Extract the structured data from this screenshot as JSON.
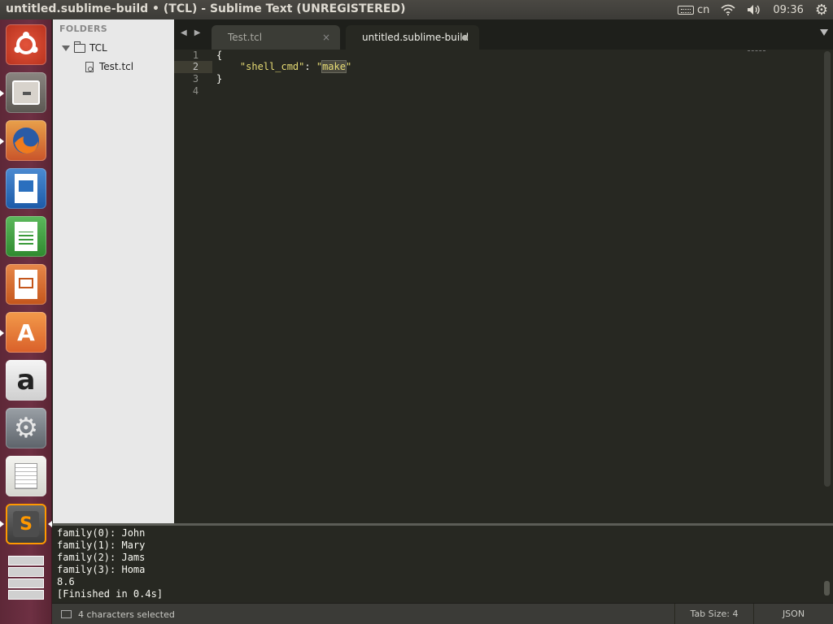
{
  "window": {
    "title": "untitled.sublime-build • (TCL) - Sublime Text (UNREGISTERED)"
  },
  "indicators": {
    "keyboard": "cn",
    "clock": "09:36"
  },
  "launcher": {
    "items": [
      "Ubuntu Dash",
      "Files",
      "Firefox Web Browser",
      "LibreOffice Writer",
      "LibreOffice Calc",
      "LibreOffice Impress",
      "Ubuntu Software Center",
      "Amazon",
      "System Settings",
      "Text Editor",
      "Sublime Text",
      "Workspace Switcher"
    ]
  },
  "sidebar": {
    "header": "FOLDERS",
    "folder": "TCL",
    "file": "Test.tcl"
  },
  "tabs": [
    {
      "label": "Test.tcl",
      "active": false,
      "close": "×"
    },
    {
      "label": "untitled.sublime-build",
      "active": true,
      "modified": true
    }
  ],
  "editor": {
    "line_numbers": [
      "1",
      "2",
      "3",
      "4"
    ],
    "code": {
      "l1": "{",
      "l2_indent": "    ",
      "l2_key": "\"shell_cmd\"",
      "l2_colon": ": ",
      "l2_q1": "\"",
      "l2_sel": "make",
      "l2_q2": "\"",
      "l3": "}"
    }
  },
  "output": {
    "lines": [
      "family(0): John",
      "family(1): Mary",
      "family(2): Jams",
      "family(3): Homa",
      "8.6",
      "[Finished in 0.4s]"
    ]
  },
  "statusbar": {
    "selection": "4 characters selected",
    "tab_size": "Tab Size: 4",
    "syntax": "JSON"
  },
  "colors": {
    "editor_bg": "#272822",
    "string": "#e6db74",
    "launcher": "#6e3043"
  }
}
